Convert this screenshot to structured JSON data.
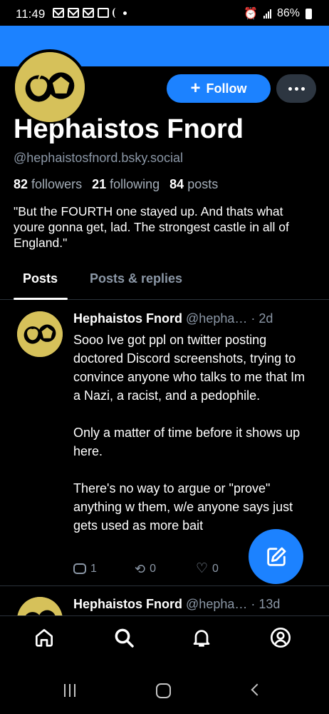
{
  "status_bar": {
    "time": "11:49",
    "battery": "86%"
  },
  "profile": {
    "display_name": "Hephaistos Fnord",
    "handle": "@hephaistosfnord.bsky.social",
    "followers_count": "82",
    "followers_label": "followers",
    "following_count": "21",
    "following_label": "following",
    "posts_count": "84",
    "posts_label": "posts",
    "bio": "\"But the FOURTH one stayed up. And thats what youre gonna get, lad. The strongest castle in all of England.\"",
    "follow_label": "Follow",
    "banner_color": "#1c82ff",
    "avatar_color": "#d6c15a"
  },
  "tabs": [
    {
      "label": "Posts",
      "active": true
    },
    {
      "label": "Posts & replies",
      "active": false
    }
  ],
  "posts": [
    {
      "author": "Hephaistos Fnord",
      "handle": "@hepha…",
      "time": "· 2d",
      "paragraphs": [
        "Sooo Ive got ppl on twitter posting doctored Discord screenshots, trying to convince anyone who talks to me that Im a Nazi, a racist, and a pedophile.",
        "Only a matter of time before it shows up here.",
        "There's no way to argue or \"prove\" anything w them, w/e anyone says just gets used as more bait"
      ],
      "replies": "1",
      "reposts": "0",
      "likes": "0"
    },
    {
      "author": "Hephaistos Fnord",
      "handle": "@hepha…",
      "time": "· 13d"
    }
  ],
  "icons": {
    "nav": [
      "home-icon",
      "search-icon",
      "bell-icon",
      "profile-icon"
    ],
    "fab": "compose-icon"
  },
  "colors": {
    "accent": "#1c82ff",
    "muted_text": "#8b97a6",
    "background": "#000000"
  }
}
